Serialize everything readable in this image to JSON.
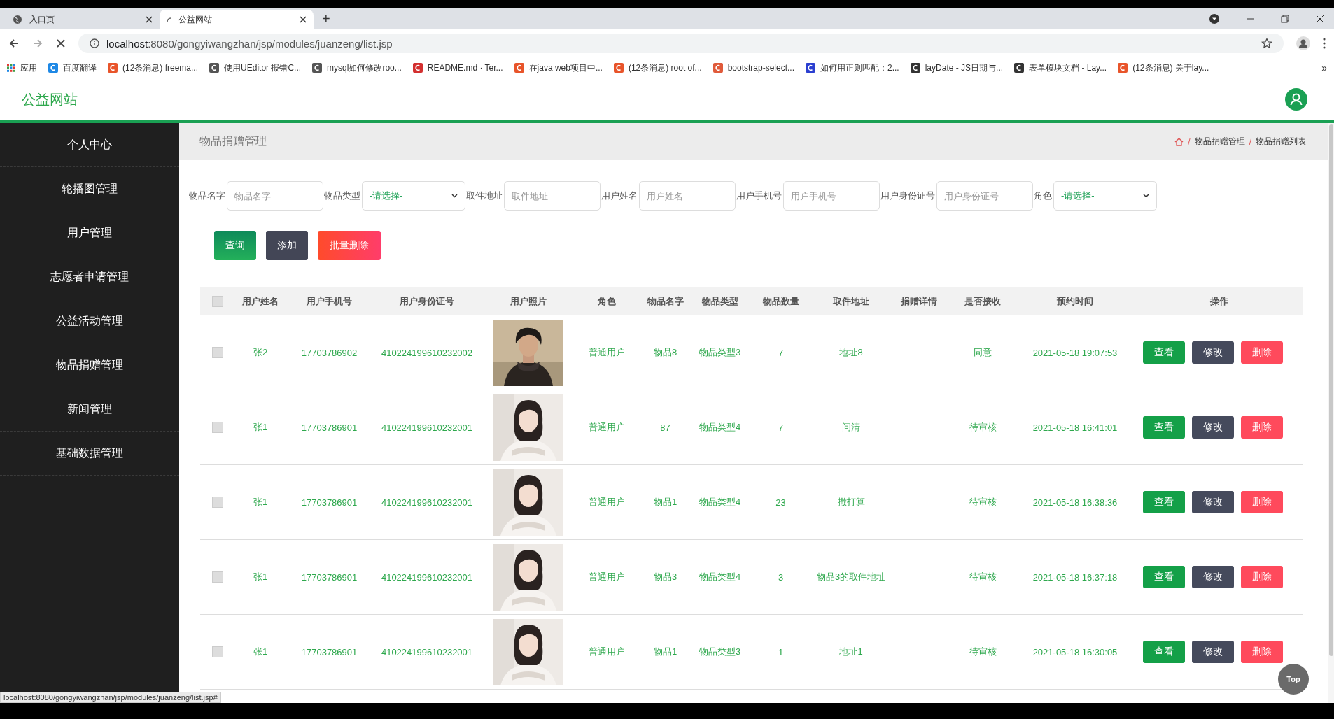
{
  "browser": {
    "tabs": [
      {
        "title": "入口页",
        "selected": false
      },
      {
        "title": "公益网站",
        "selected": true
      }
    ],
    "new_tab": "+",
    "address_host": "localhost",
    "address_rest": ":8080/gongyiwangzhan/jsp/modules/juanzeng/list.jsp",
    "bookmarks": [
      "应用",
      "百度翻译",
      "(12条消息) freema...",
      "使用UEditor 报错C...",
      "mysql如何修改roo...",
      "README.md · Ter...",
      "在java web项目中...",
      "(12条消息) root of...",
      "bootstrap-select...",
      "如何用正则匹配：2...",
      "layDate - JS日期与...",
      "表单模块文档 - Lay...",
      "(12条消息) 关于lay..."
    ],
    "more": "»"
  },
  "site": {
    "title": "公益网站"
  },
  "sidebar": {
    "items": [
      "个人中心",
      "轮播图管理",
      "用户管理",
      "志愿者申请管理",
      "公益活动管理",
      "物品捐赠管理",
      "新闻管理",
      "基础数据管理"
    ]
  },
  "page": {
    "title": "物品捐赠管理",
    "breadcrumb_separator": "/",
    "breadcrumb": [
      "物品捐赠管理",
      "物品捐赠列表"
    ]
  },
  "filters": [
    {
      "label": "物品名字",
      "kind": "input",
      "placeholder": "物品名字"
    },
    {
      "label": "物品类型",
      "kind": "select",
      "value": "-请选择-"
    },
    {
      "label": "取件地址",
      "kind": "input",
      "placeholder": "取件地址"
    },
    {
      "label": "用户姓名",
      "kind": "input",
      "placeholder": "用户姓名"
    },
    {
      "label": "用户手机号",
      "kind": "input",
      "placeholder": "用户手机号"
    },
    {
      "label": "用户身份证号",
      "kind": "input",
      "placeholder": "用户身份证号"
    },
    {
      "label": "角色",
      "kind": "select",
      "value": "-请选择-"
    }
  ],
  "actions": [
    {
      "label": "查询",
      "kind": "search"
    },
    {
      "label": "添加",
      "kind": "add"
    },
    {
      "label": "批量删除",
      "kind": "delete"
    }
  ],
  "table": {
    "header_checked": false,
    "columns": [
      "用户姓名",
      "用户手机号",
      "用户身份证号",
      "用户照片",
      "角色",
      "物品名字",
      "物品类型",
      "物品数量",
      "取件地址",
      "捐赠详情",
      "是否接收",
      "预约时间",
      "操作"
    ],
    "rows": [
      {
        "checked": false,
        "name": "张2",
        "phone": "17703786902",
        "id_number": "410224199610232002",
        "role": "普通用户",
        "item_name": "物品8",
        "item_type": "物品类型3",
        "quantity": "7",
        "address": "地址8",
        "accepted": "同意",
        "time": "2021-05-18 19:07:53",
        "actions": [
          "查看",
          "修改",
          "删除"
        ]
      },
      {
        "checked": false,
        "name": "张1",
        "phone": "17703786901",
        "id_number": "410224199610232001",
        "role": "普通用户",
        "item_name": "87",
        "item_type": "物品类型4",
        "quantity": "7",
        "address": "问清",
        "accepted": "待审核",
        "time": "2021-05-18 16:41:01",
        "actions": [
          "查看",
          "修改",
          "删除"
        ]
      },
      {
        "checked": false,
        "name": "张1",
        "phone": "17703786901",
        "id_number": "410224199610232001",
        "role": "普通用户",
        "item_name": "物品1",
        "item_type": "物品类型4",
        "quantity": "23",
        "address": "撒打算",
        "accepted": "待审核",
        "time": "2021-05-18 16:38:36",
        "actions": [
          "查看",
          "修改",
          "删除"
        ]
      },
      {
        "checked": false,
        "name": "张1",
        "phone": "17703786901",
        "id_number": "410224199610232001",
        "role": "普通用户",
        "item_name": "物品3",
        "item_type": "物品类型4",
        "quantity": "3",
        "address": "物品3的取件地址",
        "accepted": "待审核",
        "time": "2021-05-18 16:37:18",
        "actions": [
          "查看",
          "修改",
          "删除"
        ]
      },
      {
        "checked": false,
        "name": "张1",
        "phone": "17703786901",
        "id_number": "410224199610232001",
        "role": "普通用户",
        "item_name": "物品1",
        "item_type": "物品类型3",
        "quantity": "1",
        "address": "地址1",
        "accepted": "待审核",
        "time": "2021-05-18 16:30:05",
        "actions": [
          "查看",
          "修改",
          "删除"
        ]
      }
    ]
  },
  "top_button": "Top",
  "status_url": "localhost:8080/gongyiwangzhan/jsp/modules/juanzeng/list.jsp#"
}
